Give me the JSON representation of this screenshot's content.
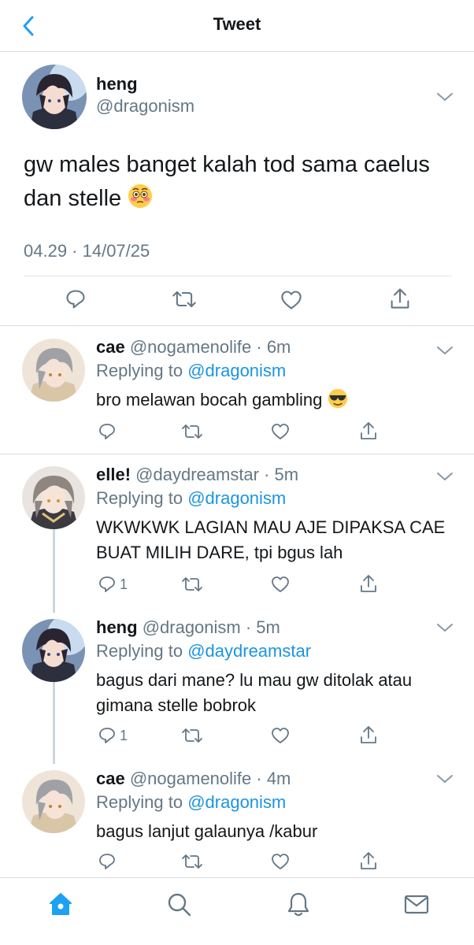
{
  "header": {
    "title": "Tweet"
  },
  "main_tweet": {
    "name": "heng",
    "handle": "@dragonism",
    "text": "gw males banget kalah tod sama caelus dan stelle",
    "emoji": "flushed-face-emoji",
    "timestamp": "04.29 · 14/07/25"
  },
  "replies": [
    {
      "name": "cae",
      "handle_time": "@nogamenolife · 6m",
      "replying_prefix": "Replying to",
      "replying_to": "@dragonism",
      "text": "bro melawan bocah gambling",
      "emoji": "sunglasses-face-emoji",
      "reply_count": ""
    },
    {
      "name": "elle!",
      "handle_time": "@daydreamstar · 5m",
      "replying_prefix": "Replying to",
      "replying_to": "@dragonism",
      "text": "WKWKWK LAGIAN MAU AJE DIPAKSA CAE BUAT MILIH DARE, tpi bgus lah",
      "reply_count": "1"
    },
    {
      "name": "heng",
      "handle_time": "@dragonism · 5m",
      "replying_prefix": "Replying to",
      "replying_to": "@daydreamstar",
      "text": "bagus dari mane? lu mau gw ditolak atau gimana stelle bobrok",
      "reply_count": "1"
    },
    {
      "name": "cae",
      "handle_time": "@nogamenolife · 4m",
      "replying_prefix": "Replying to",
      "replying_to": "@dragonism",
      "text": "bagus lanjut galaunya /kabur",
      "reply_count": ""
    }
  ],
  "tabbar": {
    "items": [
      "home-icon",
      "search-icon",
      "notifications-icon",
      "messages-icon"
    ]
  },
  "colors": {
    "accent": "#1da1f2",
    "link": "#1b95e0",
    "secondary_text": "#657786",
    "border": "#d6dbe0"
  }
}
